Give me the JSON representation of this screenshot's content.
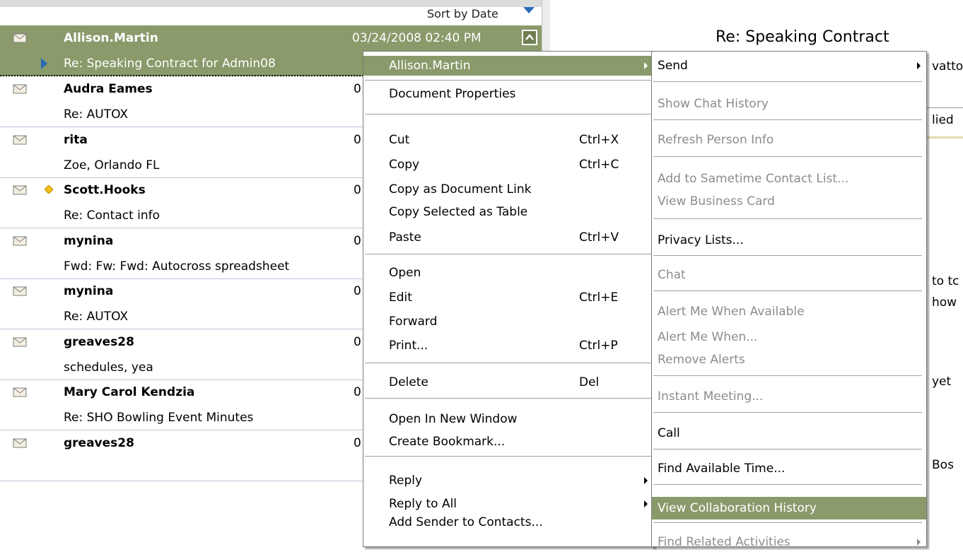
{
  "list": {
    "sort_label": "Sort by Date",
    "selected": {
      "sender": "Allison.Martin",
      "date": "03/24/2008 02:40 PM",
      "subject": "Re: Speaking Contract for Admin08"
    },
    "rows": [
      {
        "sender": "Audra Eames",
        "subject": "Re: AUTOX",
        "date_fragment": "0"
      },
      {
        "sender": "rita",
        "subject": "Zoe, Orlando FL",
        "date_fragment": "0"
      },
      {
        "sender": "Scott.Hooks",
        "subject": "Re: Contact info",
        "date_fragment": "0"
      },
      {
        "sender": "mynina",
        "subject": "Fwd: Fw: Fwd: Autocross spreadsheet",
        "date_fragment": "0"
      },
      {
        "sender": "mynina",
        "subject": "Re: AUTOX",
        "date_fragment": "0"
      },
      {
        "sender": "greaves28",
        "subject": "schedules, yea",
        "date_fragment": "0"
      },
      {
        "sender": "Mary Carol Kendzia",
        "subject": "Re: SHO Bowling Event Minutes",
        "date_fragment": "0"
      },
      {
        "sender": "greaves28",
        "subject": "",
        "date_fragment": "0"
      }
    ]
  },
  "preview": {
    "title": "Re: Speaking Contract",
    "fragments": [
      "vatto",
      "lied",
      "to tc",
      "how",
      "yet",
      "Bos"
    ]
  },
  "menu_main": {
    "items": [
      {
        "label": "Allison.Martin",
        "shortcut": "",
        "submenu": true
      },
      {
        "label": "Document Properties",
        "shortcut": "",
        "submenu": false
      },
      {
        "label": "Cut",
        "shortcut": "Ctrl+X",
        "submenu": false
      },
      {
        "label": "Copy",
        "shortcut": "Ctrl+C",
        "submenu": false
      },
      {
        "label": "Copy as Document Link",
        "shortcut": "",
        "submenu": false
      },
      {
        "label": "Copy Selected as Table",
        "shortcut": "",
        "submenu": false
      },
      {
        "label": "Paste",
        "shortcut": "Ctrl+V",
        "submenu": false
      },
      {
        "label": "Open",
        "shortcut": "",
        "submenu": false
      },
      {
        "label": "Edit",
        "shortcut": "Ctrl+E",
        "submenu": false
      },
      {
        "label": "Forward",
        "shortcut": "",
        "submenu": false
      },
      {
        "label": "Print...",
        "shortcut": "Ctrl+P",
        "submenu": false
      },
      {
        "label": "Delete",
        "shortcut": "Del",
        "submenu": false
      },
      {
        "label": "Open In New Window",
        "shortcut": "",
        "submenu": false
      },
      {
        "label": "Create Bookmark...",
        "shortcut": "",
        "submenu": false
      },
      {
        "label": "Reply",
        "shortcut": "",
        "submenu": true
      },
      {
        "label": "Reply to All",
        "shortcut": "",
        "submenu": true
      },
      {
        "label": "Add Sender to Contacts...",
        "shortcut": "",
        "submenu": false
      }
    ]
  },
  "menu_sub": {
    "items": [
      {
        "label": "Send",
        "enabled": true,
        "submenu": true
      },
      {
        "label": "Show Chat History",
        "enabled": false,
        "submenu": false
      },
      {
        "label": "Refresh Person Info",
        "enabled": false,
        "submenu": false
      },
      {
        "label": "Add to Sametime Contact List...",
        "enabled": false,
        "submenu": false
      },
      {
        "label": "View Business Card",
        "enabled": false,
        "submenu": false
      },
      {
        "label": "Privacy Lists...",
        "enabled": true,
        "submenu": false
      },
      {
        "label": "Chat",
        "enabled": false,
        "submenu": false
      },
      {
        "label": "Alert Me When Available",
        "enabled": false,
        "submenu": false
      },
      {
        "label": "Alert Me When...",
        "enabled": false,
        "submenu": false
      },
      {
        "label": "Remove Alerts",
        "enabled": false,
        "submenu": false
      },
      {
        "label": "Instant Meeting...",
        "enabled": false,
        "submenu": false
      },
      {
        "label": "Call",
        "enabled": true,
        "submenu": false
      },
      {
        "label": "Find Available Time...",
        "enabled": true,
        "submenu": false
      },
      {
        "label": "View Collaboration History",
        "enabled": true,
        "submenu": false,
        "highlighted": true
      },
      {
        "label": "Find Related Activities",
        "enabled": false,
        "submenu": true
      }
    ]
  },
  "colors": {
    "selection": "#8a9a6b",
    "accent_blue": "#2b6cb8",
    "disabled_text": "#8c8c8c"
  },
  "icons": {
    "envelope": "envelope-icon",
    "flag": "diamond-flag-icon",
    "collapse": "chevron-up-icon"
  }
}
